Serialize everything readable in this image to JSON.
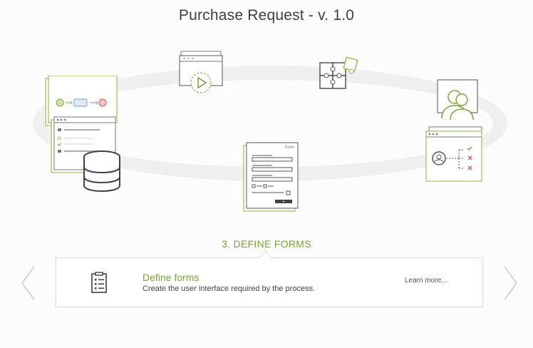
{
  "header": {
    "title": "Purchase Request - v. 1.0"
  },
  "stages": [
    {
      "name": "process-model-icon"
    },
    {
      "name": "simulation-icon"
    },
    {
      "name": "integration-icon"
    },
    {
      "name": "participants-icon"
    },
    {
      "name": "forms-icon"
    }
  ],
  "current_step": {
    "label": "3. DEFINE FORMS",
    "title": "Define forms",
    "description": "Create the user interface required by the process.",
    "link": "Learn more..."
  },
  "form_preview": {
    "header": "Form"
  },
  "colors": {
    "accent": "#7aa33a",
    "ring": "#efefef",
    "icon_stroke": "#3d4149"
  },
  "nav": {
    "prev_icon": "chevron-left-icon",
    "next_icon": "chevron-right-icon"
  }
}
